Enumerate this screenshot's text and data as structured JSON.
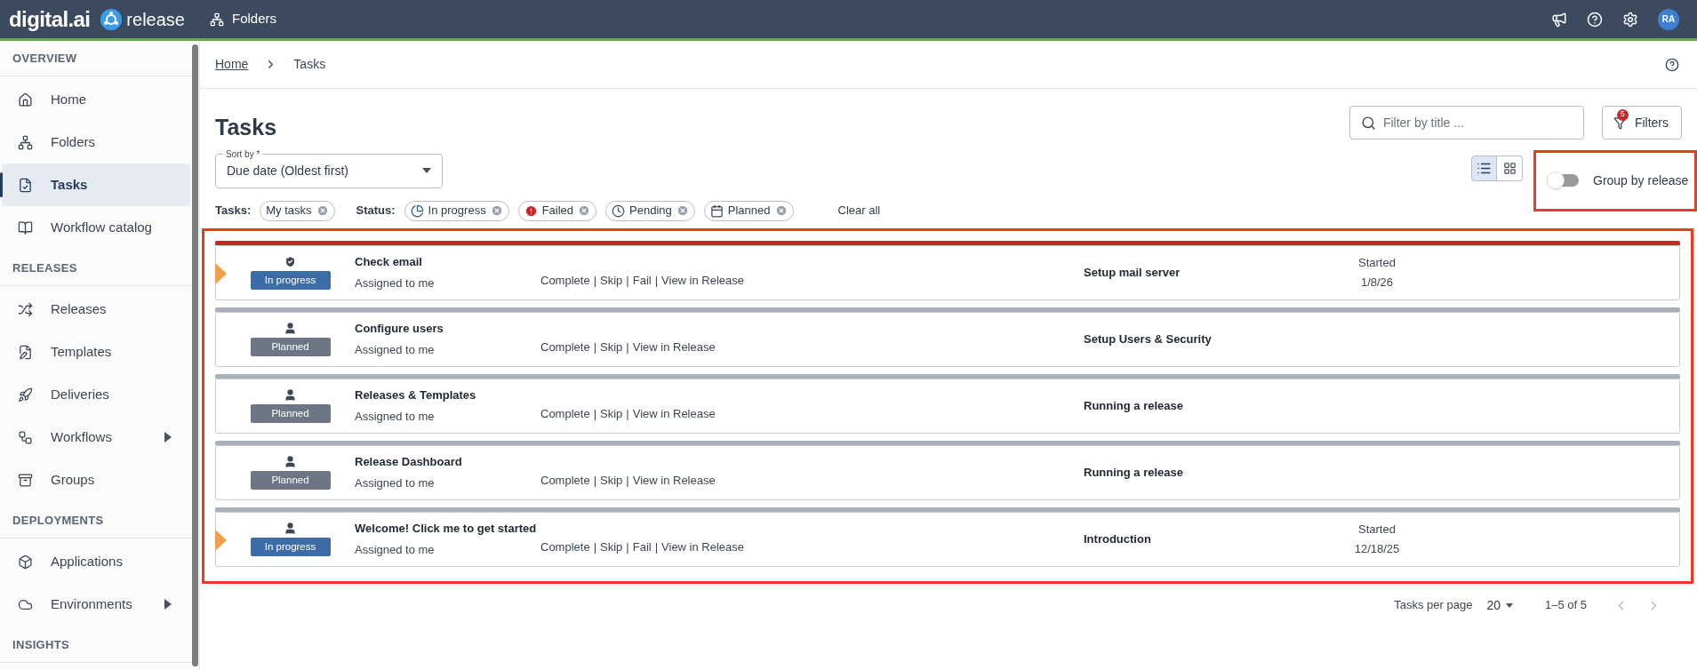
{
  "topbar": {
    "logo": "digital.ai",
    "product": "release",
    "breadcrumb": "Folders",
    "avatar": "RA"
  },
  "sidebar": {
    "sections": [
      {
        "title": "OVERVIEW",
        "items": [
          {
            "label": "Home",
            "selected": false,
            "has_submenu": false
          },
          {
            "label": "Folders",
            "selected": false,
            "has_submenu": false
          },
          {
            "label": "Tasks",
            "selected": true,
            "has_submenu": false
          },
          {
            "label": "Workflow catalog",
            "selected": false,
            "has_submenu": false
          }
        ]
      },
      {
        "title": "RELEASES",
        "items": [
          {
            "label": "Releases",
            "selected": false,
            "has_submenu": false
          },
          {
            "label": "Templates",
            "selected": false,
            "has_submenu": false
          },
          {
            "label": "Deliveries",
            "selected": false,
            "has_submenu": false
          },
          {
            "label": "Workflows",
            "selected": false,
            "has_submenu": true
          },
          {
            "label": "Groups",
            "selected": false,
            "has_submenu": false
          }
        ]
      },
      {
        "title": "DEPLOYMENTS",
        "items": [
          {
            "label": "Applications",
            "selected": false,
            "has_submenu": false
          },
          {
            "label": "Environments",
            "selected": false,
            "has_submenu": true
          }
        ]
      },
      {
        "title": "INSIGHTS"
      }
    ]
  },
  "breadcrumbs": [
    {
      "label": "Home",
      "link": true
    },
    {
      "label": "Tasks",
      "link": false
    }
  ],
  "page_title": "Tasks",
  "search": {
    "placeholder": "Filter by title ..."
  },
  "filters_button": {
    "label": "Filters",
    "badge": "5"
  },
  "sort": {
    "label": "Sort by *",
    "value": "Due date (Oldest first)"
  },
  "view_modes": [
    {
      "kind": "list",
      "selected": true
    },
    {
      "kind": "grid",
      "selected": false
    }
  ],
  "group_by_release": {
    "label": "Group by release",
    "on": false
  },
  "filter_groups": [
    {
      "label": "Tasks:",
      "chips": [
        {
          "label": "My tasks",
          "kind": "plain"
        }
      ]
    },
    {
      "label": "Status:",
      "chips": [
        {
          "label": "In progress",
          "kind": "in_progress"
        },
        {
          "label": "Failed",
          "kind": "failed"
        },
        {
          "label": "Pending",
          "kind": "pending"
        },
        {
          "label": "Planned",
          "kind": "planned"
        }
      ]
    }
  ],
  "clear_all": "Clear all",
  "separator": "|",
  "tasks": [
    {
      "title": "Check email",
      "assignee": "Assigned to me",
      "status": {
        "label": "In progress",
        "color": "#3d6da6"
      },
      "kind": "gate",
      "color": "#c62828",
      "active_marker": true,
      "actions": [
        "Complete",
        "Skip",
        "Fail",
        "View in Release"
      ],
      "release": "Setup mail server",
      "started_label": "Started",
      "started_date": "1/8/26"
    },
    {
      "title": "Configure users",
      "assignee": "Assigned to me",
      "status": {
        "label": "Planned",
        "color": "#6c7684"
      },
      "kind": "user",
      "color": "#a9b0b9",
      "active_marker": false,
      "actions": [
        "Complete",
        "Skip",
        "View in Release"
      ],
      "release": "Setup Users & Security"
    },
    {
      "title": "Releases & Templates",
      "assignee": "Assigned to me",
      "status": {
        "label": "Planned",
        "color": "#6c7684"
      },
      "kind": "user",
      "color": "#a9b0b9",
      "active_marker": false,
      "actions": [
        "Complete",
        "Skip",
        "View in Release"
      ],
      "release": "Running a release"
    },
    {
      "title": "Release Dashboard",
      "assignee": "Assigned to me",
      "status": {
        "label": "Planned",
        "color": "#6c7684"
      },
      "kind": "user",
      "color": "#a9b0b9",
      "active_marker": false,
      "actions": [
        "Complete",
        "Skip",
        "View in Release"
      ],
      "release": "Running a release"
    },
    {
      "title": "Welcome! Click me to get started",
      "assignee": "Assigned to me",
      "status": {
        "label": "In progress",
        "color": "#3d6da6"
      },
      "kind": "user",
      "color": "#a9b0b9",
      "active_marker": true,
      "actions": [
        "Complete",
        "Skip",
        "Fail",
        "View in Release"
      ],
      "release": "Introduction",
      "started_label": "Started",
      "started_date": "12/18/25"
    }
  ],
  "pagination": {
    "label": "Tasks per page",
    "per_page": "20",
    "range": "1–5 of 5"
  }
}
